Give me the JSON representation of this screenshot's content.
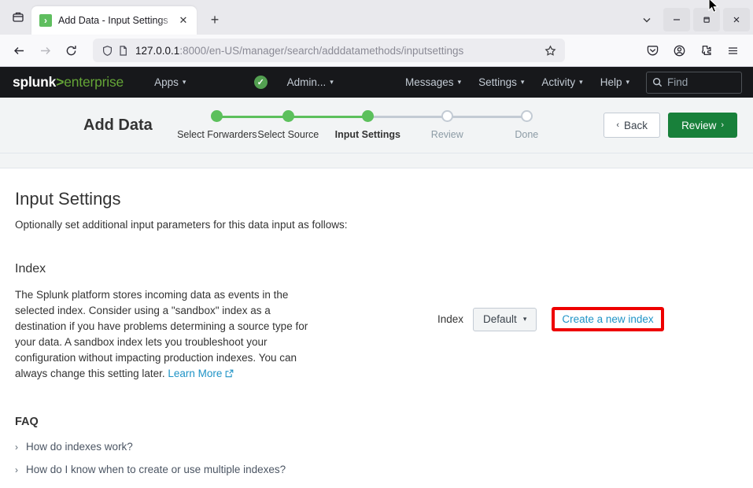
{
  "browser": {
    "tab": {
      "title": "Add Data - Input Settings",
      "favicon_glyph": "›",
      "close_glyph": "✕"
    },
    "newtab_glyph": "+",
    "tablist_icon": "list-all-tabs-icon",
    "url": {
      "host": "127.0.0.1",
      "rest": ":8000/en-US/manager/search/adddatamethods/inputsettings",
      "full": "127.0.0.1:8000/en-US/manager/search/adddatamethods/inputsettings"
    },
    "window_controls": {
      "minimize": "—",
      "maximize": "❐",
      "close": "✕",
      "chevron": "⌄"
    }
  },
  "splunk_nav": {
    "logo_prefix": "splunk",
    "logo_chevron": ">",
    "logo_suffix": "enterprise",
    "items": [
      {
        "label": "Apps",
        "caret": "▾"
      },
      {
        "label": "Admin...",
        "caret": "▾"
      },
      {
        "label": "Messages",
        "caret": "▾"
      },
      {
        "label": "Settings",
        "caret": "▾"
      },
      {
        "label": "Activity",
        "caret": "▾"
      },
      {
        "label": "Help",
        "caret": "▾"
      }
    ],
    "health_glyph": "✓",
    "find_placeholder": "Find",
    "accent_green": "#65a637"
  },
  "wizard": {
    "title": "Add Data",
    "steps": [
      {
        "label": "Select Forwarders",
        "state": "done"
      },
      {
        "label": "Select Source",
        "state": "done"
      },
      {
        "label": "Input Settings",
        "state": "current"
      },
      {
        "label": "Review",
        "state": "future"
      },
      {
        "label": "Done",
        "state": "future"
      }
    ],
    "back_label": "Back",
    "back_glyph": "‹",
    "review_label": "Review",
    "review_glyph": "›",
    "review_color": "#18803a"
  },
  "page": {
    "title": "Input Settings",
    "subtitle": "Optionally set additional input parameters for this data input as follows:",
    "index_section": {
      "heading": "Index",
      "description": "The Splunk platform stores incoming data as events in the selected index. Consider using a \"sandbox\" index as a destination if you have problems determining a source type for your data. A sandbox index lets you troubleshoot your configuration without impacting production indexes. You can always change this setting later.",
      "learn_more": "Learn More",
      "field_label": "Index",
      "select_value": "Default",
      "select_caret": "▾",
      "create_index_link": "Create a new index",
      "highlight_color": "#ee0000"
    },
    "faq": {
      "heading": "FAQ",
      "items": [
        {
          "chevron": "›",
          "label": "How do indexes work?"
        },
        {
          "chevron": "›",
          "label": "How do I know when to create or use multiple indexes?"
        }
      ]
    }
  }
}
